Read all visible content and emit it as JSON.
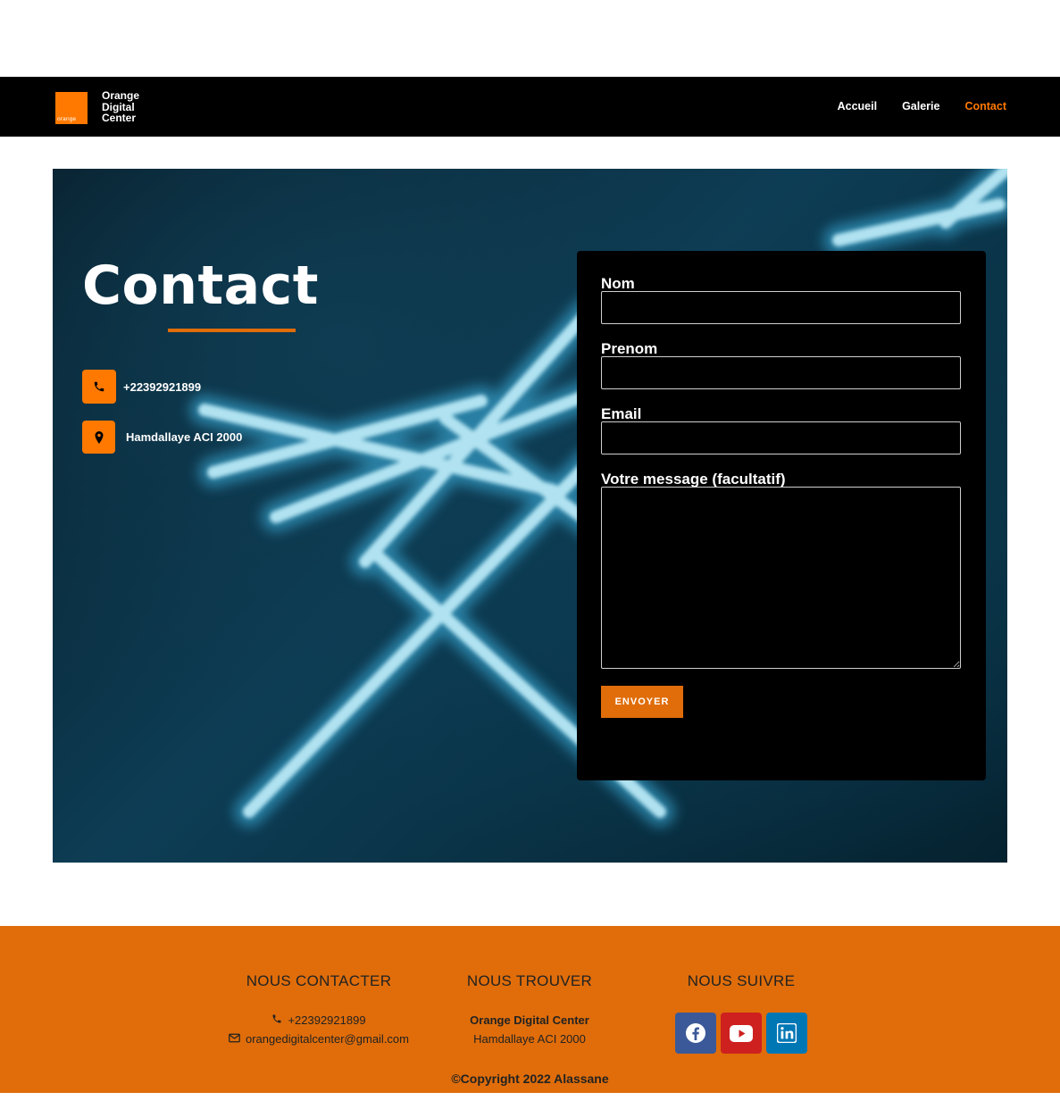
{
  "header": {
    "logo_small": "orange",
    "logo_lines": [
      "Orange",
      "Digital",
      "Center"
    ],
    "nav": [
      {
        "label": "Accueil",
        "active": false
      },
      {
        "label": "Galerie",
        "active": false
      },
      {
        "label": "Contact",
        "active": true
      }
    ]
  },
  "hero": {
    "title": "Contact",
    "phone": "+22392921899",
    "address": "Hamdallaye ACI 2000"
  },
  "form": {
    "name_label": "Nom",
    "firstname_label": "Prenom",
    "email_label": "Email",
    "message_label": "Votre message (facultatif)",
    "submit_label": "ENVOYER"
  },
  "footer": {
    "contact_heading": "NOUS CONTACTER",
    "contact_phone": "+22392921899",
    "contact_email": "orangedigitalcenter@gmail.com",
    "find_heading": "NOUS TROUVER",
    "find_line1": "Orange Digital Center",
    "find_line2": "Hamdallaye ACI 2000",
    "follow_heading": "NOUS SUIVRE",
    "social": [
      "facebook-icon",
      "youtube-icon",
      "linkedin-icon"
    ],
    "copyright": "©Copyright 2022 Alassane"
  },
  "colors": {
    "accent": "#e06d0a",
    "brand_orange": "#ff7900",
    "facebook": "#3b5998",
    "youtube": "#cd201f",
    "linkedin": "#0077b5"
  }
}
